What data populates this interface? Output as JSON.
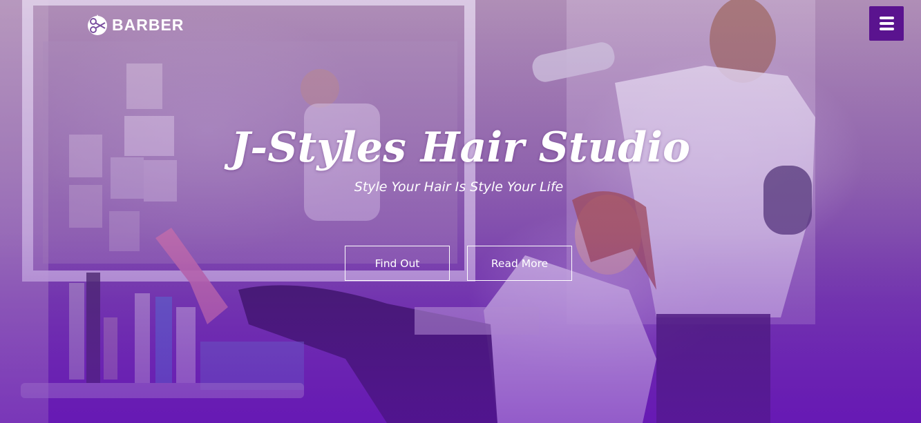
{
  "header": {
    "logo_text": "BARBER",
    "logo_icon": "scissors-comb-icon",
    "menu_icon": "hamburger-menu-icon"
  },
  "hero": {
    "title": "J-Styles Hair Studio",
    "subtitle": "Style Your Hair Is Style Your Life",
    "buttons": [
      {
        "label": "Find Out"
      },
      {
        "label": "Read More"
      }
    ]
  },
  "colors": {
    "accent": "#5a138f",
    "overlay_bottom": "#6b21b3",
    "text": "#ffffff"
  }
}
